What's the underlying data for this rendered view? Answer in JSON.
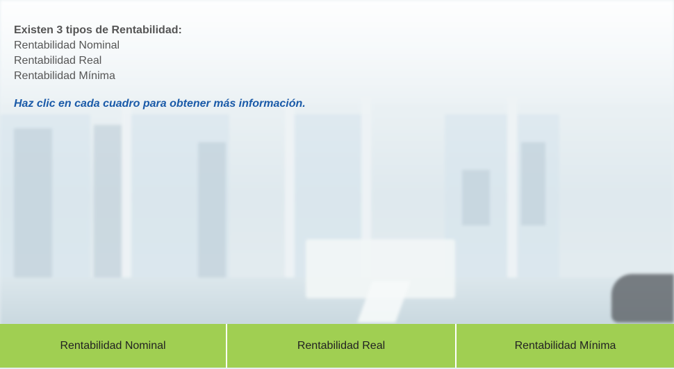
{
  "intro": {
    "heading": "Existen 3 tipos de Rentabilidad:",
    "items": [
      "Rentabilidad Nominal",
      "Rentabilidad Real",
      "Rentabilidad Mínima"
    ]
  },
  "instruction": "Haz clic en cada cuadro para obtener más información.",
  "tabs": [
    {
      "label": "Rentabilidad Nominal"
    },
    {
      "label": "Rentabilidad Real"
    },
    {
      "label": "Rentabilidad Mínima"
    }
  ],
  "colors": {
    "tab_background": "#a0cf52",
    "instruction_text": "#1a5aa8",
    "body_text": "#555555"
  }
}
